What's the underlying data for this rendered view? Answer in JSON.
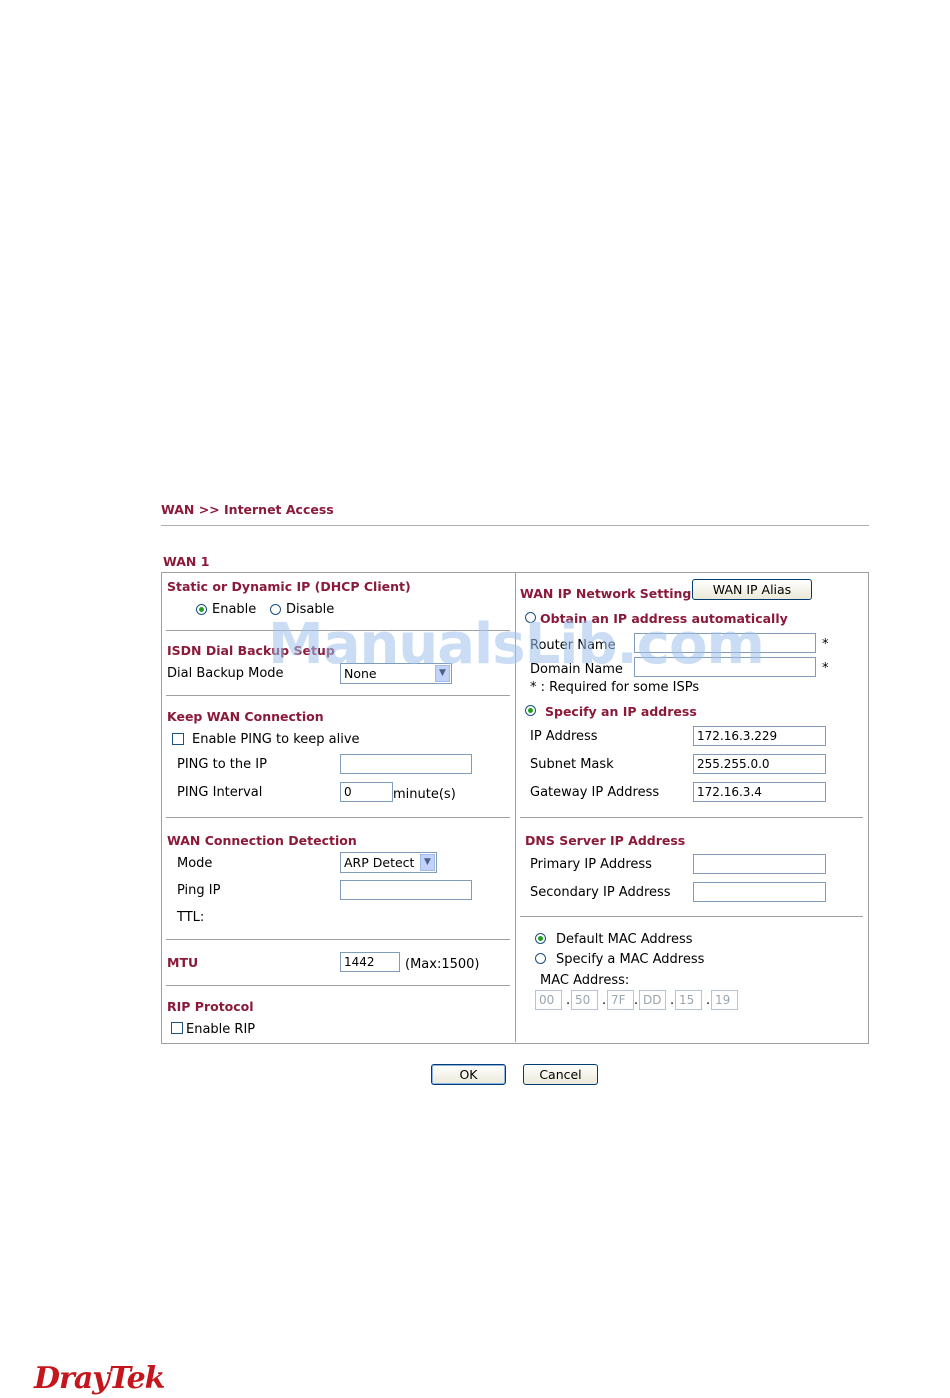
{
  "breadcrumb": "WAN >> Internet Access",
  "wan_title": "WAN 1",
  "left": {
    "dhcp": {
      "title": "Static or Dynamic IP (DHCP Client)",
      "enable": "Enable",
      "disable": "Disable",
      "selected": "Enable"
    },
    "isdn": {
      "title": "ISDN Dial Backup Setup",
      "mode_label": "Dial Backup Mode",
      "mode_value": "None"
    },
    "keep": {
      "title": "Keep WAN Connection",
      "ping_check": "Enable PING to keep alive",
      "ping_ip_label": "PING to the IP",
      "ping_ip_value": "",
      "interval_label": "PING Interval",
      "interval_value": "0",
      "interval_unit": "minute(s)"
    },
    "detect": {
      "title": "WAN Connection Detection",
      "mode_label": "Mode",
      "mode_value": "ARP Detect",
      "ping_label": "Ping IP",
      "ping_value": "",
      "ttl_label": "TTL:"
    },
    "mtu": {
      "title": "MTU",
      "value": "1442",
      "max": "(Max:1500)"
    },
    "rip": {
      "title": "RIP Protocol",
      "check": "Enable RIP"
    }
  },
  "right": {
    "title": "WAN IP Network Settings",
    "alias_button": "WAN IP Alias",
    "obtain": "Obtain an IP address automatically",
    "router_name_label": "Router Name",
    "router_name_value": "",
    "domain_name_label": "Domain Name",
    "domain_name_value": "",
    "required_mark": "*",
    "required_note": "* : Required for some ISPs",
    "specify": "Specify an IP address",
    "ip_label": "IP Address",
    "ip_value": "172.16.3.229",
    "mask_label": "Subnet Mask",
    "mask_value": "255.255.0.0",
    "gw_label": "Gateway IP Address",
    "gw_value": "172.16.3.4",
    "dns_title": "DNS Server IP Address",
    "primary_label": "Primary IP Address",
    "primary_value": "",
    "secondary_label": "Secondary IP Address",
    "secondary_value": "",
    "default_mac": "Default MAC Address",
    "specify_mac": "Specify a MAC Address",
    "mac_label": "MAC Address:",
    "mac": [
      "00",
      "50",
      "7F",
      "DD",
      "15",
      "19"
    ],
    "mac_sep": "."
  },
  "buttons": {
    "ok": "OK",
    "cancel": "Cancel"
  },
  "watermark": "ManualsLib.com",
  "logo": "DrayTek"
}
